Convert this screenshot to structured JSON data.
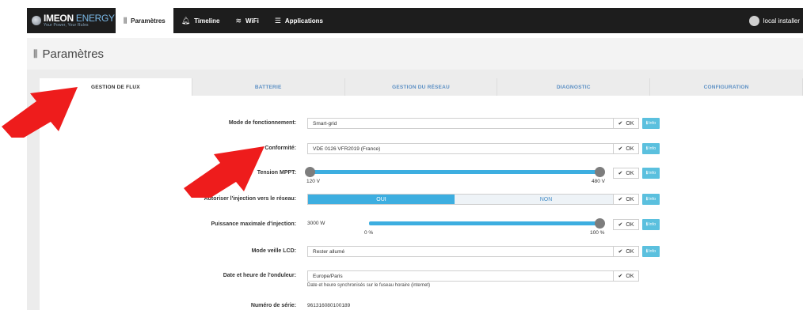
{
  "nav": {
    "brand_name_a": "IMEON",
    "brand_name_b": " ENERGY",
    "brand_tagline": "Your Power, Your Rules",
    "items": [
      {
        "label": "Paramètres",
        "icon": "sliders-icon"
      },
      {
        "label": "Timeline",
        "icon": "bell-icon"
      },
      {
        "label": "WiFi",
        "icon": "wifi-icon"
      },
      {
        "label": "Applications",
        "icon": "list-icon"
      }
    ],
    "user_label": "local installer"
  },
  "header": {
    "title": "Paramètres"
  },
  "tabs": [
    "GESTION DE FLUX",
    "BATTERIE",
    "GESTION DU RÉSEAU",
    "DIAGNOSTIC",
    "CONFIGURATION"
  ],
  "form": {
    "mode": {
      "label": "Mode de fonctionnement:",
      "value": "Smart-grid"
    },
    "conformite": {
      "label": "Conformité:",
      "value": "VDE 0126 VFR2019 (France)"
    },
    "mppt": {
      "label": "Tension MPPT:",
      "min_label": "120 V",
      "max_label": "480 V",
      "low": 120,
      "high": 480
    },
    "injection": {
      "label": "Autoriser l'injection vers le réseau:",
      "oui": "OUI",
      "non": "NON",
      "selected": "OUI"
    },
    "puissance": {
      "label": "Puissance maximale d'injection:",
      "value": "3000 W",
      "min_label": "0 %",
      "max_label": "100 %",
      "level_percent": 100
    },
    "veille": {
      "label": "Mode veille LCD:",
      "value": "Rester allumé"
    },
    "date": {
      "label": "Date et heure de l'onduleur:",
      "value": "Europe/Paris",
      "note": "Date et heure synchronisés sur le fuseau horaire (internet)"
    },
    "serie": {
      "label": "Numéro de série:",
      "value": "961316080100189"
    },
    "ok_label": "OK",
    "info_label": "Info"
  },
  "colors": {
    "accent": "#3daee0",
    "info": "#5bc0de",
    "arrow": "#ee1c1c",
    "navbar": "#1d1d1d"
  }
}
